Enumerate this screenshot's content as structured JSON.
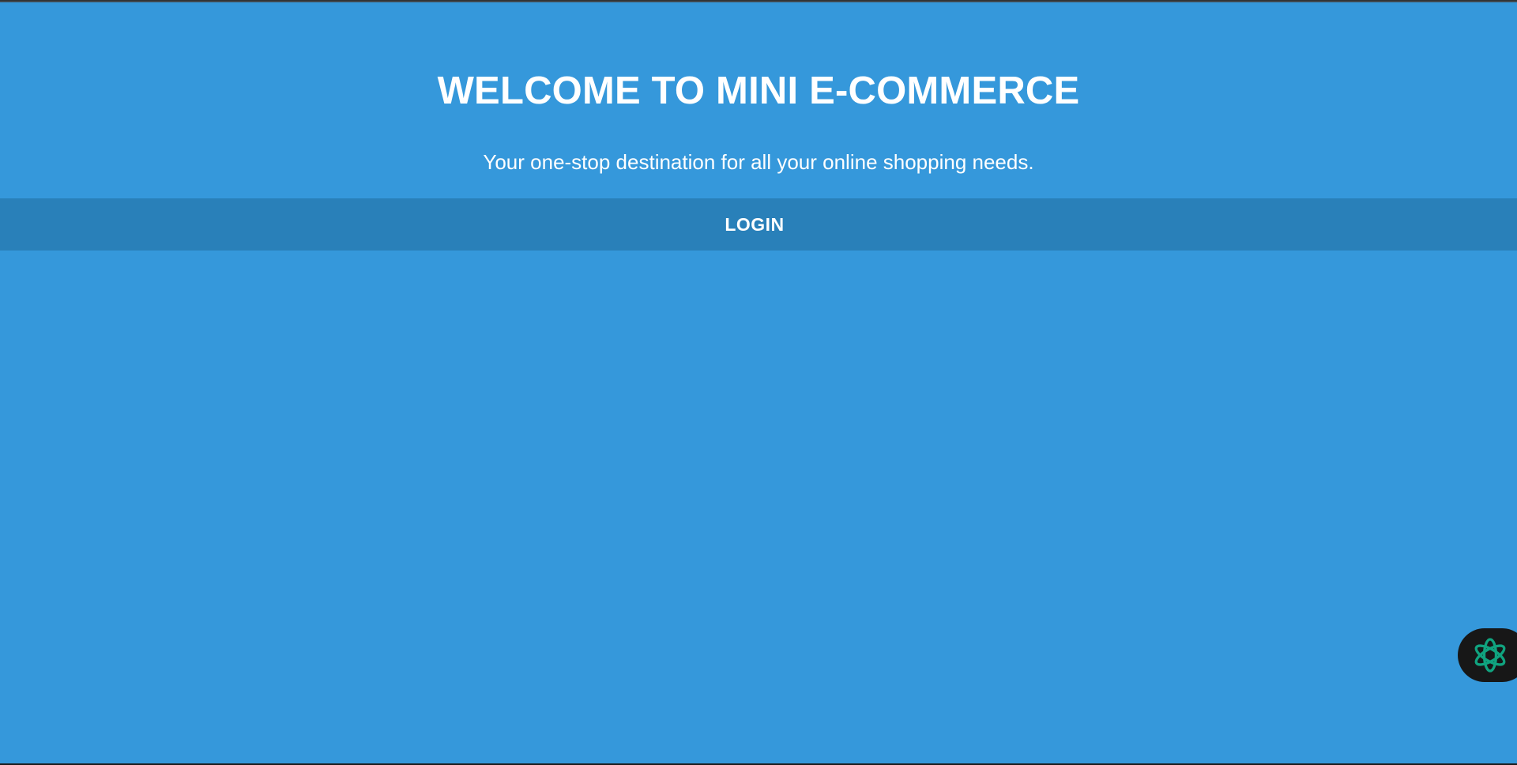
{
  "hero": {
    "title": "WELCOME TO MINI E-COMMERCE",
    "subtitle": "Your one-stop destination for all your online shopping needs."
  },
  "nav": {
    "login_label": "LOGIN"
  },
  "widget": {
    "icon": "ai-assistant-icon"
  },
  "colors": {
    "background": "#3598db",
    "navbar": "#2980b9",
    "text": "#ffffff",
    "widget_bg": "#171717",
    "widget_icon": "#10a37f"
  }
}
